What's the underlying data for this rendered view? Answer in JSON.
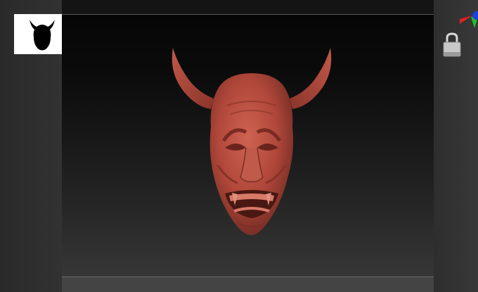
{
  "app": {
    "viewport_bg_top": "#050505",
    "viewport_bg_bottom": "#3a3a3a",
    "mask_color": "#b5493b"
  },
  "left_panel": {
    "thumbnail_icon": "horned-mask-silhouette-icon"
  },
  "right_panel": {
    "gizmo_icon": "axis-gizmo-icon",
    "lock_icon": "lock-icon",
    "axis_colors": {
      "x": "#e02020",
      "y": "#20c020",
      "z": "#2040e0"
    }
  }
}
